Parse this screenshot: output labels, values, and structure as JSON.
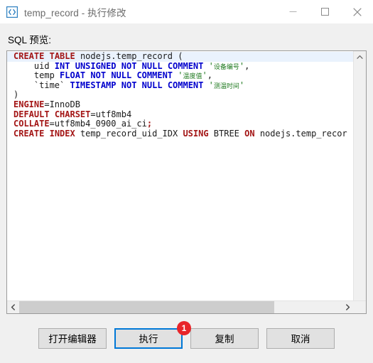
{
  "window": {
    "icon": "code-brackets-icon",
    "title": "temp_record - 执行修改",
    "controls": {
      "minimize": "minimize-icon",
      "maximize": "maximize-icon",
      "close": "close-icon"
    }
  },
  "main": {
    "sql_label": "SQL 预览:",
    "editor": {
      "current_line_index": 0,
      "lines": [
        {
          "index": 0,
          "text": "CREATE TABLE nodejs.temp_record (",
          "tokens": [
            {
              "t": "CREATE",
              "c": "k"
            },
            {
              "t": " ",
              "c": "p"
            },
            {
              "t": "TABLE",
              "c": "k"
            },
            {
              "t": " nodejs.temp_record (",
              "c": "id"
            }
          ]
        },
        {
          "index": 1,
          "text": "    uid INT UNSIGNED NOT NULL COMMENT '设备编号',",
          "tokens": [
            {
              "t": "    uid ",
              "c": "id"
            },
            {
              "t": "INT",
              "c": "t"
            },
            {
              "t": " ",
              "c": "p"
            },
            {
              "t": "UNSIGNED",
              "c": "t"
            },
            {
              "t": " ",
              "c": "p"
            },
            {
              "t": "NOT",
              "c": "t"
            },
            {
              "t": " ",
              "c": "p"
            },
            {
              "t": "NULL",
              "c": "t"
            },
            {
              "t": " ",
              "c": "p"
            },
            {
              "t": "COMMENT",
              "c": "t"
            },
            {
              "t": " ",
              "c": "p"
            },
            {
              "t": "'",
              "c": "str"
            },
            {
              "t": "设备编号",
              "c": "cn"
            },
            {
              "t": "'",
              "c": "str"
            },
            {
              "t": ",",
              "c": "p"
            }
          ]
        },
        {
          "index": 2,
          "text": "    temp FLOAT NOT NULL COMMENT '温度值',",
          "tokens": [
            {
              "t": "    temp ",
              "c": "id"
            },
            {
              "t": "FLOAT",
              "c": "t"
            },
            {
              "t": " ",
              "c": "p"
            },
            {
              "t": "NOT",
              "c": "t"
            },
            {
              "t": " ",
              "c": "p"
            },
            {
              "t": "NULL",
              "c": "t"
            },
            {
              "t": " ",
              "c": "p"
            },
            {
              "t": "COMMENT",
              "c": "t"
            },
            {
              "t": " ",
              "c": "p"
            },
            {
              "t": "'",
              "c": "str"
            },
            {
              "t": "温度值",
              "c": "cn"
            },
            {
              "t": "'",
              "c": "str"
            },
            {
              "t": ",",
              "c": "p"
            }
          ]
        },
        {
          "index": 3,
          "text": "    `time` TIMESTAMP NOT NULL COMMENT '测温时间'",
          "tokens": [
            {
              "t": "    `time` ",
              "c": "id"
            },
            {
              "t": "TIMESTAMP",
              "c": "t"
            },
            {
              "t": " ",
              "c": "p"
            },
            {
              "t": "NOT",
              "c": "t"
            },
            {
              "t": " ",
              "c": "p"
            },
            {
              "t": "NULL",
              "c": "t"
            },
            {
              "t": " ",
              "c": "p"
            },
            {
              "t": "COMMENT",
              "c": "t"
            },
            {
              "t": " ",
              "c": "p"
            },
            {
              "t": "'",
              "c": "str"
            },
            {
              "t": "测温时间",
              "c": "cn"
            },
            {
              "t": "'",
              "c": "str"
            }
          ]
        },
        {
          "index": 4,
          "text": ")",
          "tokens": [
            {
              "t": ")",
              "c": "id"
            }
          ]
        },
        {
          "index": 5,
          "text": "ENGINE=InnoDB",
          "tokens": [
            {
              "t": "ENGINE",
              "c": "k"
            },
            {
              "t": "=InnoDB",
              "c": "id"
            }
          ]
        },
        {
          "index": 6,
          "text": "DEFAULT CHARSET=utf8mb4",
          "tokens": [
            {
              "t": "DEFAULT",
              "c": "k"
            },
            {
              "t": " ",
              "c": "p"
            },
            {
              "t": "CHARSET",
              "c": "k"
            },
            {
              "t": "=utf8mb4",
              "c": "id"
            }
          ]
        },
        {
          "index": 7,
          "text": "COLLATE=utf8mb4_0900_ai_ci;",
          "tokens": [
            {
              "t": "COLLATE",
              "c": "k"
            },
            {
              "t": "=utf8mb4_0900_ai_ci",
              "c": "id"
            },
            {
              "t": ";",
              "c": "k"
            }
          ]
        },
        {
          "index": 8,
          "text": "CREATE INDEX temp_record_uid_IDX USING BTREE ON nodejs.temp_recor",
          "tokens": [
            {
              "t": "CREATE",
              "c": "k"
            },
            {
              "t": " ",
              "c": "p"
            },
            {
              "t": "INDEX",
              "c": "k"
            },
            {
              "t": " temp_record_uid_IDX ",
              "c": "id"
            },
            {
              "t": "USING",
              "c": "k"
            },
            {
              "t": " BTREE ",
              "c": "id"
            },
            {
              "t": "ON",
              "c": "k"
            },
            {
              "t": " nodejs.temp_recor",
              "c": "id"
            }
          ]
        }
      ]
    },
    "scrollbars": {
      "vertical_up": "chevron-up-icon",
      "horizontal_left": "chevron-left-icon",
      "horizontal_right": "chevron-right-icon",
      "horizontal_thumb_percent": 79
    }
  },
  "footer": {
    "badge": "1",
    "buttons": [
      {
        "label": "打开编辑器",
        "focused": false
      },
      {
        "label": "执行",
        "focused": true
      },
      {
        "label": "复制",
        "focused": false
      },
      {
        "label": "取消",
        "focused": false
      }
    ]
  },
  "colors": {
    "accent": "#0078d7",
    "badge": "#e8252a",
    "keyword": "#a31515",
    "type": "#0000cd",
    "string": "#1f7a1f",
    "current_line": "#eaf2fd"
  }
}
